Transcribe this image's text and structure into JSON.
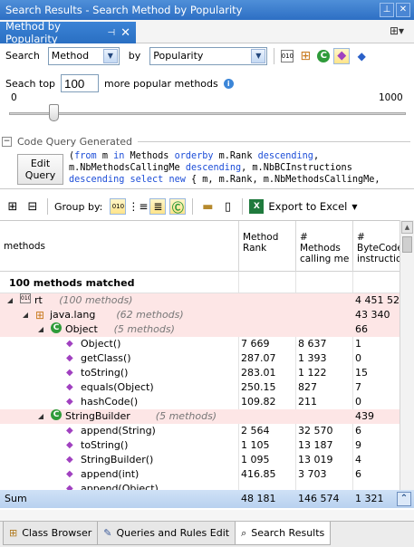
{
  "window": {
    "title": "Search Results - Search Method by Popularity"
  },
  "doc_tab": {
    "label": "Method by Popularity"
  },
  "search": {
    "label": "Search",
    "kind_value": "Method",
    "by_label": "by",
    "criteria_value": "Popularity",
    "top_label": "Seach top",
    "top_value": "100",
    "top_suffix": "more popular methods",
    "slider_min": "0",
    "slider_max": "1000",
    "slider_fraction": 0.1
  },
  "code_query": {
    "header": "Code Query Generated",
    "edit_button": "Edit Query",
    "lines": [
      "(from m in Methods orderby m.Rank descending,",
      "m.NbMethodsCallingMe descending, m.NbBCInstructions",
      "descending select new { m, m.Rank, m.NbMethodsCallingMe,"
    ]
  },
  "toolbar": {
    "group_by_label": "Group by:",
    "export_label": "Export to Excel"
  },
  "grid": {
    "columns": [
      {
        "label": "methods"
      },
      {
        "label": "Method Rank"
      },
      {
        "label": "# Methods calling me"
      },
      {
        "label": "# ByteCode instructions"
      }
    ],
    "matched_label": "100 methods matched",
    "rows": [
      {
        "level": 0,
        "kind": "group",
        "icon": "assembly-icon",
        "expander": "◢",
        "name": "rt",
        "meta": "(100 methods)",
        "rank": "",
        "callers": "",
        "instr": "4 451 523"
      },
      {
        "level": 1,
        "kind": "group",
        "icon": "namespace-icon",
        "expander": "◢",
        "name": "java.lang",
        "meta": "(62 methods)",
        "rank": "",
        "callers": "",
        "instr": "43 340"
      },
      {
        "level": 2,
        "kind": "group",
        "icon": "class-icon",
        "expander": "◢",
        "name": "Object",
        "meta": "(5 methods)",
        "rank": "",
        "callers": "",
        "instr": "66"
      },
      {
        "level": 3,
        "kind": "method",
        "icon": "method-icon",
        "name": "Object()",
        "rank": "7 669",
        "callers": "8 637",
        "instr": "1"
      },
      {
        "level": 3,
        "kind": "method",
        "icon": "method-icon",
        "name": "getClass()",
        "rank": "287.07",
        "callers": "1 393",
        "instr": "0"
      },
      {
        "level": 3,
        "kind": "method",
        "icon": "method-icon",
        "name": "toString()",
        "rank": "283.01",
        "callers": "1 122",
        "instr": "15"
      },
      {
        "level": 3,
        "kind": "method",
        "icon": "method-icon",
        "name": "equals(Object)",
        "rank": "250.15",
        "callers": "827",
        "instr": "7"
      },
      {
        "level": 3,
        "kind": "method",
        "icon": "method-icon",
        "name": "hashCode()",
        "rank": "109.82",
        "callers": "211",
        "instr": "0"
      },
      {
        "level": 2,
        "kind": "group",
        "icon": "class-icon",
        "expander": "◢",
        "name": "StringBuilder",
        "meta": "(5 methods)",
        "rank": "",
        "callers": "",
        "instr": "439"
      },
      {
        "level": 3,
        "kind": "method",
        "icon": "method-icon",
        "name": "append(String)",
        "rank": "2 564",
        "callers": "32 570",
        "instr": "6"
      },
      {
        "level": 3,
        "kind": "method",
        "icon": "method-icon",
        "name": "toString()",
        "rank": "1 105",
        "callers": "13 187",
        "instr": "9"
      },
      {
        "level": 3,
        "kind": "method",
        "icon": "method-icon",
        "name": "StringBuilder()",
        "rank": "1 095",
        "callers": "13 019",
        "instr": "4"
      },
      {
        "level": 3,
        "kind": "method",
        "icon": "method-icon",
        "name": "append(int)",
        "rank": "416.85",
        "callers": "3 703",
        "instr": "6"
      },
      {
        "level": 3,
        "kind": "method",
        "icon": "method-icon",
        "name": "append(Object)",
        "rank": "",
        "callers": "",
        "instr": ""
      }
    ]
  },
  "sum": {
    "label": "Sum",
    "rank": "48 181",
    "callers": "146 574",
    "instr": "1 321"
  },
  "bottom_tabs": [
    {
      "label": "Class Browser",
      "icon": "class-browser-icon"
    },
    {
      "label": "Queries and Rules Edit",
      "icon": "queries-icon"
    },
    {
      "label": "Search Results",
      "icon": "search-icon",
      "active": true
    }
  ],
  "colors": {
    "title_bg": "#3b7bd0",
    "group_row": "#fde6e6",
    "sum_bg": "#c6dbf3"
  }
}
